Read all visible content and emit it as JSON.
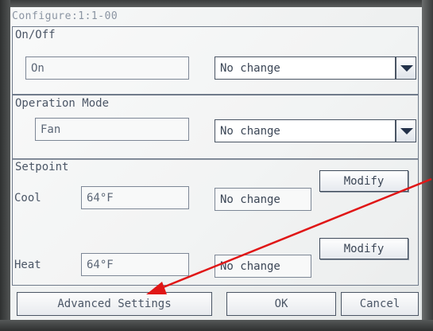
{
  "title": "Configure:1:1-00",
  "on_off": {
    "label": "On/Off",
    "current": "On",
    "selected": "No change"
  },
  "operation_mode": {
    "label": "Operation Mode",
    "current": "Fan",
    "selected": "No change"
  },
  "setpoint": {
    "label": "Setpoint",
    "cool": {
      "label": "Cool",
      "current": "64°F",
      "new": "No change",
      "button": "Modify"
    },
    "heat": {
      "label": "Heat",
      "current": "64°F",
      "new": "No change",
      "button": "Modify"
    }
  },
  "buttons": {
    "advanced": "Advanced Settings",
    "ok": "OK",
    "cancel": "Cancel"
  },
  "annotation": {
    "arrow_color": "#e01616",
    "icon": "red-arrow-icon"
  }
}
